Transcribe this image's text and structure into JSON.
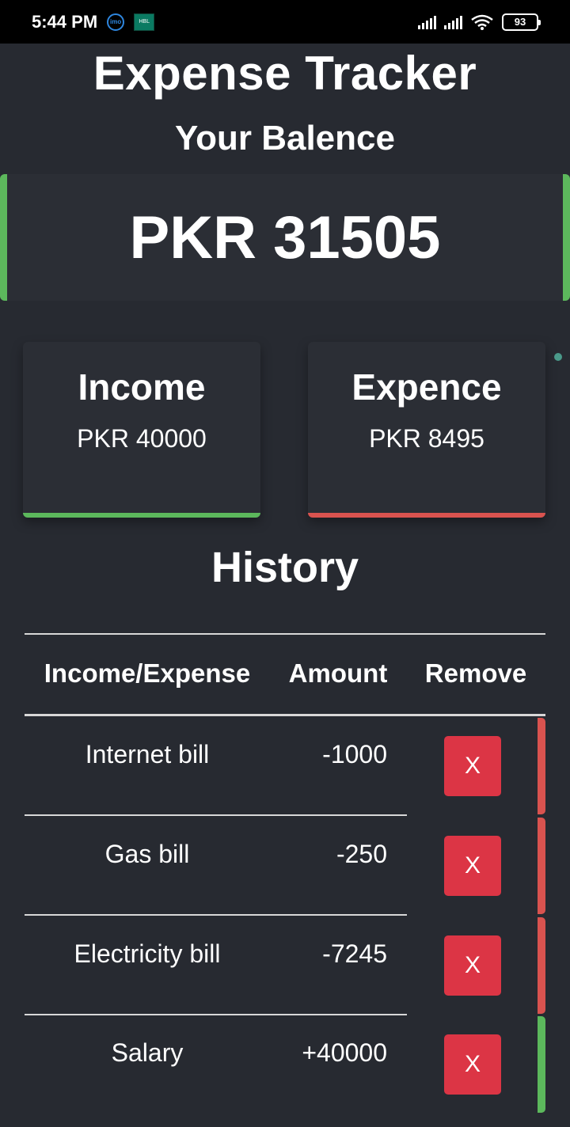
{
  "status_bar": {
    "time": "5:44 PM",
    "imo_label": "imo",
    "hbl_label": "HBL",
    "battery": "93"
  },
  "app": {
    "title": "Expense Tracker",
    "balance_label": "Your Balence",
    "balance": "PKR 31505"
  },
  "summary": {
    "income_label": "Income",
    "income_amount": "PKR 40000",
    "expense_label": "Expence",
    "expense_amount": "PKR 8495"
  },
  "history": {
    "title": "History",
    "columns": [
      "Income/Expense",
      "Amount",
      "Remove"
    ],
    "rows": [
      {
        "name": "Internet bill",
        "amount": "-1000",
        "remove": "X",
        "type": "expense"
      },
      {
        "name": "Gas bill",
        "amount": "-250",
        "remove": "X",
        "type": "expense"
      },
      {
        "name": "Electricity bill",
        "amount": "-7245",
        "remove": "X",
        "type": "expense"
      },
      {
        "name": "Salary",
        "amount": "+40000",
        "remove": "X",
        "type": "income"
      }
    ]
  },
  "colors": {
    "background": "#272a31",
    "card": "#2b2e35",
    "income": "#5cb85c",
    "expense": "#d9534f",
    "remove_button": "#dc3545"
  }
}
